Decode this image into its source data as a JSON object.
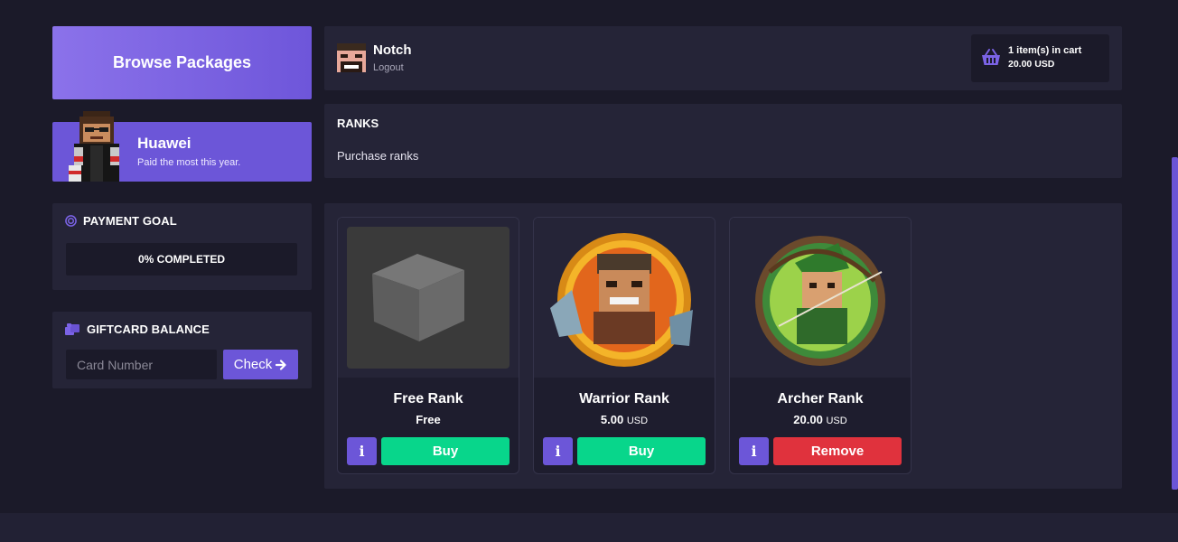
{
  "sidebar": {
    "browse_label": "Browse Packages",
    "top_donor": {
      "name": "Huawei",
      "subtitle": "Paid the most this year."
    },
    "payment_goal": {
      "title": "PAYMENT GOAL",
      "progress_label": "0% COMPLETED",
      "progress": 0
    },
    "giftcard": {
      "title": "GIFTCARD BALANCE",
      "placeholder": "Card Number",
      "check_label": "Check"
    }
  },
  "header": {
    "username": "Notch",
    "logout_label": "Logout",
    "cart": {
      "items_label": "1 item(s) in cart",
      "total_label": "20.00 USD"
    }
  },
  "category": {
    "title": "RANKS",
    "description": "Purchase ranks"
  },
  "packages": [
    {
      "name": "Free Rank",
      "price": "Free",
      "currency": "",
      "info_label": "i",
      "action_label": "Buy",
      "action": "buy"
    },
    {
      "name": "Warrior Rank",
      "price": "5.00",
      "currency": "USD",
      "info_label": "i",
      "action_label": "Buy",
      "action": "buy"
    },
    {
      "name": "Archer Rank",
      "price": "20.00",
      "currency": "USD",
      "info_label": "i",
      "action_label": "Remove",
      "action": "remove"
    }
  ],
  "colors": {
    "background": "#1b1a29",
    "panel": "#252437",
    "accent": "#6c56d8",
    "buy": "#08d68b",
    "remove": "#e0323d"
  }
}
